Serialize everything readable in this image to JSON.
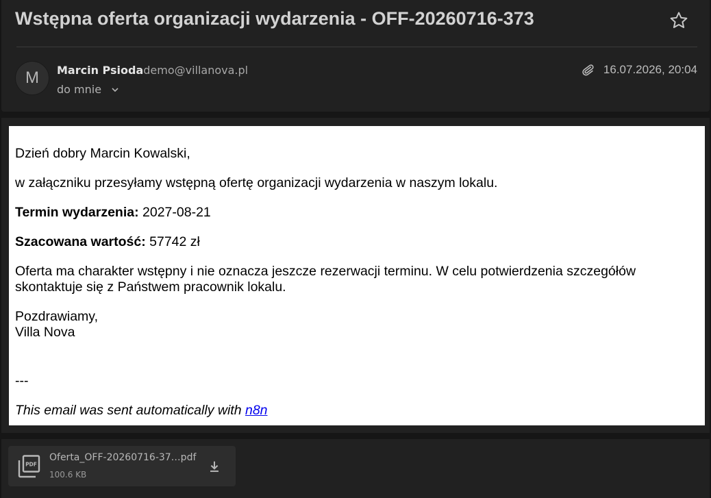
{
  "header": {
    "subject": "Wstępna oferta organizacji wydarzenia - OFF-20260716-373",
    "sender_name": "Marcin Psioda",
    "sender_email": "demo@villanova.pl",
    "avatar_letter": "M",
    "recipient": "do mnie",
    "datetime": "16.07.2026, 20:04"
  },
  "body": {
    "greeting": "Dzień dobry Marcin Kowalski,",
    "intro": "w załączniku przesyłamy wstępną ofertę organizacji wydarzenia w naszym lokalu.",
    "date_label": "Termin wydarzenia:",
    "date_value": " 2027-08-21",
    "value_label": "Szacowana wartość:",
    "value_value": " 57742 zł",
    "note": "Oferta ma charakter wstępny i nie oznacza jeszcze rezerwacji terminu. W celu potwierdzenia szczegółów skontaktuje się z Państwem pracownik lokalu.",
    "closing": "Pozdrawiamy,",
    "signature": "Villa Nova",
    "separator": "---",
    "footer_text": "This email was sent automatically with ",
    "footer_link": "n8n"
  },
  "attachment": {
    "name": "Oferta_OFF-20260716-37…pdf",
    "size": "100.6 KB",
    "icon": "pdf-file-icon"
  },
  "icons": {
    "star": "star-outline-icon",
    "clip": "paperclip-icon",
    "chevron": "chevron-down-icon",
    "download": "download-icon"
  }
}
